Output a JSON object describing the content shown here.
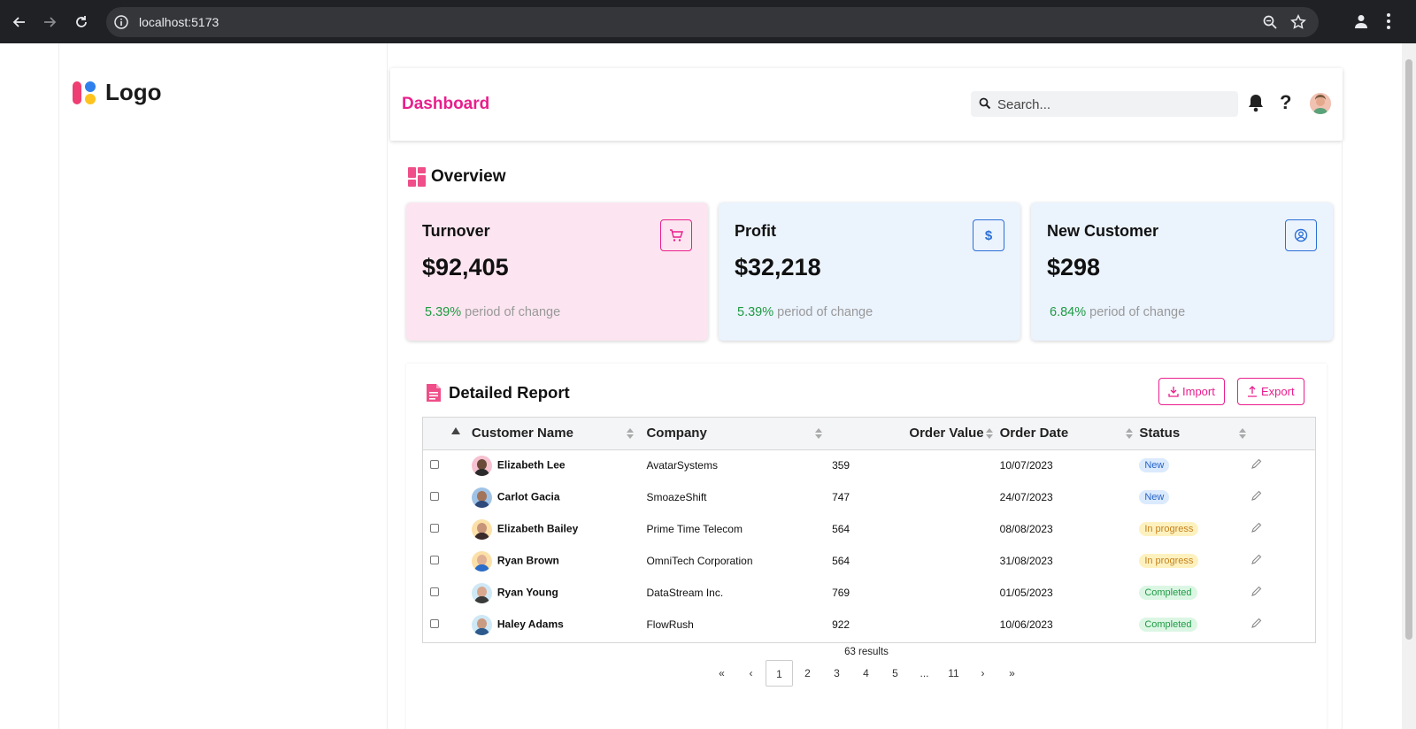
{
  "browser": {
    "url": "localhost:5173"
  },
  "brand": {
    "logo_text": "Logo"
  },
  "header": {
    "title": "Dashboard",
    "search_placeholder": "Search...",
    "help_label": "?"
  },
  "overview": {
    "title": "Overview",
    "cards": [
      {
        "title": "Turnover",
        "value": "$92,405",
        "change_pct": "5.39%",
        "change_text": "period of change",
        "icon": "cart-icon",
        "accent": "#e91e8c"
      },
      {
        "title": "Profit",
        "value": "$32,218",
        "change_pct": "5.39%",
        "change_text": "period of change",
        "icon": "dollar-icon",
        "accent": "#2b6fd6"
      },
      {
        "title": "New Customer",
        "value": "$298",
        "change_pct": "6.84%",
        "change_text": "period of change",
        "icon": "user-circle-icon",
        "accent": "#2b6fd6"
      }
    ]
  },
  "report": {
    "title": "Detailed Report",
    "import_label": "Import",
    "export_label": "Export",
    "columns": [
      "Customer Name",
      "Company",
      "Order Value",
      "Order Date",
      "Status"
    ],
    "rows": [
      {
        "name": "Elizabeth Lee",
        "company": "AvatarSystems",
        "value": "359",
        "date": "10/07/2023",
        "status": "New"
      },
      {
        "name": "Carlot Gacia",
        "company": "SmoazeShift",
        "value": "747",
        "date": "24/07/2023",
        "status": "New"
      },
      {
        "name": "Elizabeth Bailey",
        "company": "Prime Time Telecom",
        "value": "564",
        "date": "08/08/2023",
        "status": "In progress"
      },
      {
        "name": "Ryan Brown",
        "company": "OmniTech Corporation",
        "value": "564",
        "date": "31/08/2023",
        "status": "In progress"
      },
      {
        "name": "Ryan Young",
        "company": "DataStream Inc.",
        "value": "769",
        "date": "01/05/2023",
        "status": "Completed"
      },
      {
        "name": "Haley Adams",
        "company": "FlowRush",
        "value": "922",
        "date": "10/06/2023",
        "status": "Completed"
      }
    ],
    "results_text": "63 results",
    "pagination": [
      "«",
      "‹",
      "1",
      "2",
      "3",
      "4",
      "5",
      "...",
      "11",
      "›",
      "»"
    ],
    "current_page": "1"
  },
  "colors": {
    "brand_pink": "#e91e8c",
    "brand_blue": "#2b6fd6",
    "positive_green": "#1d9a41"
  }
}
